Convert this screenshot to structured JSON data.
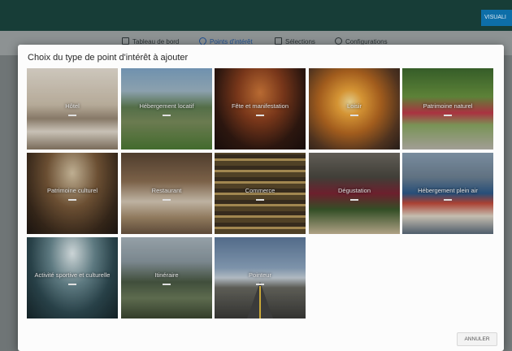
{
  "header": {
    "visualize_button": "VISUALI"
  },
  "subnav": {
    "items": [
      {
        "label": "Tableau de bord",
        "active": false
      },
      {
        "label": "Points d'intérêt",
        "active": true
      },
      {
        "label": "Sélections",
        "active": false
      },
      {
        "label": "Configurations",
        "active": false
      }
    ]
  },
  "modal": {
    "title": "Choix du type de point d'intérêt à ajouter",
    "tiles": [
      {
        "label": "Hôtel"
      },
      {
        "label": "Hébergement locatif"
      },
      {
        "label": "Fête et manifestation"
      },
      {
        "label": "Loisir"
      },
      {
        "label": "Patrimoine naturel"
      },
      {
        "label": "Patrimoine culturel"
      },
      {
        "label": "Restaurant"
      },
      {
        "label": "Commerce"
      },
      {
        "label": "Dégustation"
      },
      {
        "label": "Hébergement plein air"
      },
      {
        "label": "Activité sportive et culturelle"
      },
      {
        "label": "Itinéraire"
      },
      {
        "label": "Pointeur"
      }
    ],
    "cancel_button": "ANNULER"
  },
  "colors": {
    "app_bar": "#173d37",
    "accent_active": "#1d4f92",
    "visualize_button": "#0d6ea8"
  }
}
